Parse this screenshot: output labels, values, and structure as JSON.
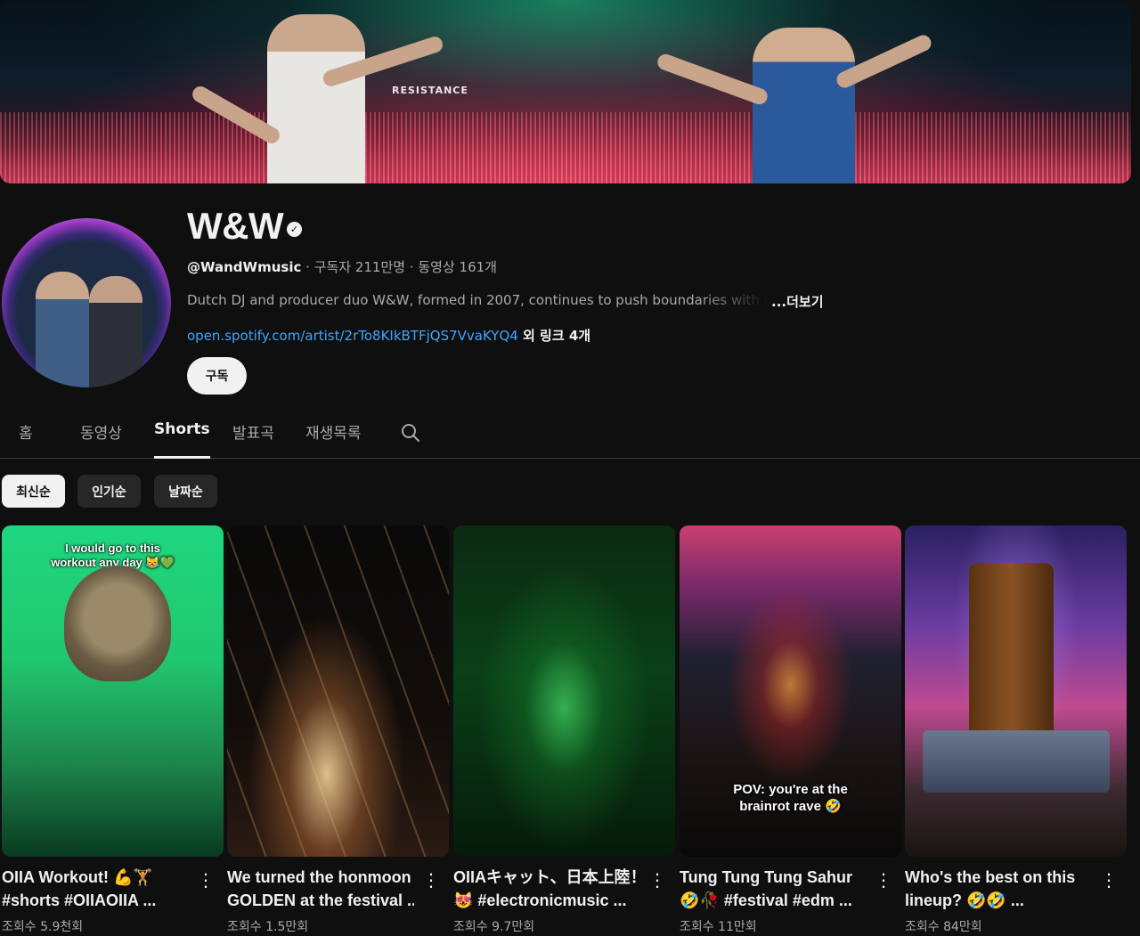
{
  "channel": {
    "name": "W&W",
    "handle": "@WandWmusic",
    "stats": " · 구독자 211만명 · 동영상 161개",
    "description": "Dutch DJ and producer duo W&W, formed in 2007, continues to push boundaries with the",
    "more_label": "...더보기",
    "link_url": "open.spotify.com/artist/2rTo8KIkBTFjQS7VvaKYQ4",
    "link_more": " 외 링크 4개",
    "subscribe_label": "구독",
    "banner_sign": "RESISTANCE"
  },
  "tabs": [
    "홈",
    "동영상",
    "Shorts",
    "발표곡",
    "재생목록"
  ],
  "active_tab": "Shorts",
  "chips": [
    "최신순",
    "인기순",
    "날짜순"
  ],
  "active_chip": "최신순",
  "shorts": [
    {
      "title_line1": "OIIA Workout! 💪🏋",
      "title_line2": "#shorts #OIIAOIIA ...",
      "views": "조회수 5.9천회",
      "overlay": "I would go to this workout any day 😹💚"
    },
    {
      "title_line1": "We turned the honmoon",
      "title_line2": "GOLDEN at the festival ..",
      "views": "조회수 1.5만회",
      "overlay": ""
    },
    {
      "title_line1": "OIIAキャット、日本上陸！",
      "title_line2": "😻 #electronicmusic ...",
      "views": "조회수 9.7만회",
      "overlay": ""
    },
    {
      "title_line1": "Tung Tung Tung Sahur",
      "title_line2": "🤣🥀 #festival #edm ...",
      "views": "조회수 11만회",
      "overlay": "POV: you're at the brainrot rave 🤣"
    },
    {
      "title_line1": "Who's the best on this",
      "title_line2": "lineup? 🤣🤣 ...",
      "views": "조회수 84만회",
      "overlay": ""
    }
  ]
}
